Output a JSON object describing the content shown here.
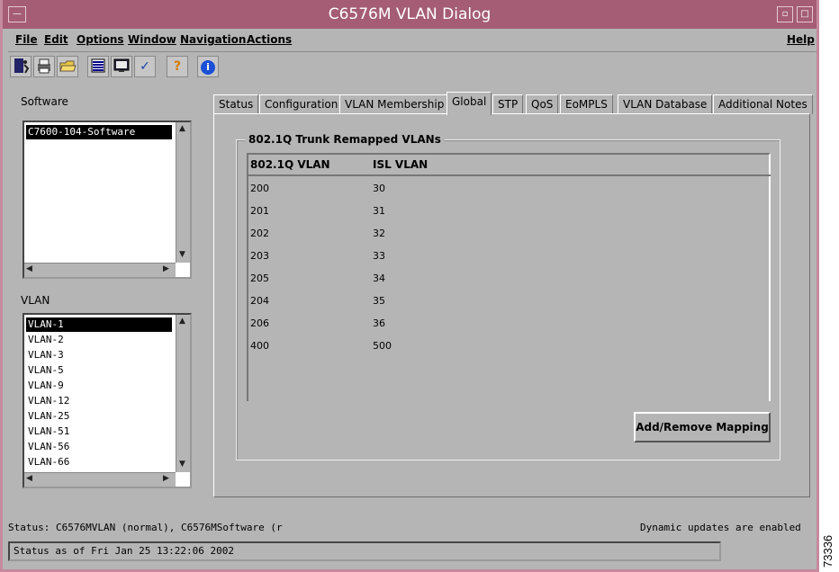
{
  "window": {
    "title": "C6576M VLAN Dialog",
    "system_menu": "—",
    "minimize": "▫",
    "maximize": "□"
  },
  "menubar": {
    "items": [
      "File",
      "Edit",
      "Options",
      "Window",
      "Navigation",
      "Actions"
    ],
    "help": "Help"
  },
  "toolbar": {
    "icons": [
      "exit-icon",
      "printer-icon",
      "folder-open-icon",
      "list-icon",
      "monitor-icon",
      "checkmark-icon",
      "help-icon",
      "info-icon"
    ],
    "help_glyph": "?",
    "info_glyph": "i",
    "check_glyph": "✓"
  },
  "software": {
    "label": "Software",
    "items": [
      "C7600-104-Software"
    ]
  },
  "vlan": {
    "label": "VLAN",
    "items": [
      "VLAN-1",
      "VLAN-2",
      "VLAN-3",
      "VLAN-5",
      "VLAN-9",
      "VLAN-12",
      "VLAN-25",
      "VLAN-51",
      "VLAN-56",
      "VLAN-66"
    ]
  },
  "tabs": [
    "Status",
    "Configuration",
    "VLAN Membership",
    "Global",
    "STP",
    "QoS",
    "EoMPLS",
    "VLAN Database",
    "Additional Notes"
  ],
  "active_tab": "Global",
  "group": {
    "title": "802.1Q Trunk Remapped VLANs",
    "headers": [
      "802.1Q VLAN",
      "ISL VLAN"
    ],
    "rows": [
      [
        "200",
        "30"
      ],
      [
        "201",
        "31"
      ],
      [
        "202",
        "32"
      ],
      [
        "203",
        "33"
      ],
      [
        "205",
        "34"
      ],
      [
        "204",
        "35"
      ],
      [
        "206",
        "36"
      ],
      [
        "400",
        "500"
      ]
    ],
    "button": "Add/Remove Mapping"
  },
  "status": {
    "line": "Status: C6576MVLAN (normal), C6576MSoftware (r",
    "updates": "Dynamic updates are enabled",
    "box": "Status as of Fri Jan 25 13:22:06 2002"
  },
  "figure_id": "73336",
  "colors": {
    "titlebar": "#a45d75",
    "background": "#b5b5b5"
  }
}
